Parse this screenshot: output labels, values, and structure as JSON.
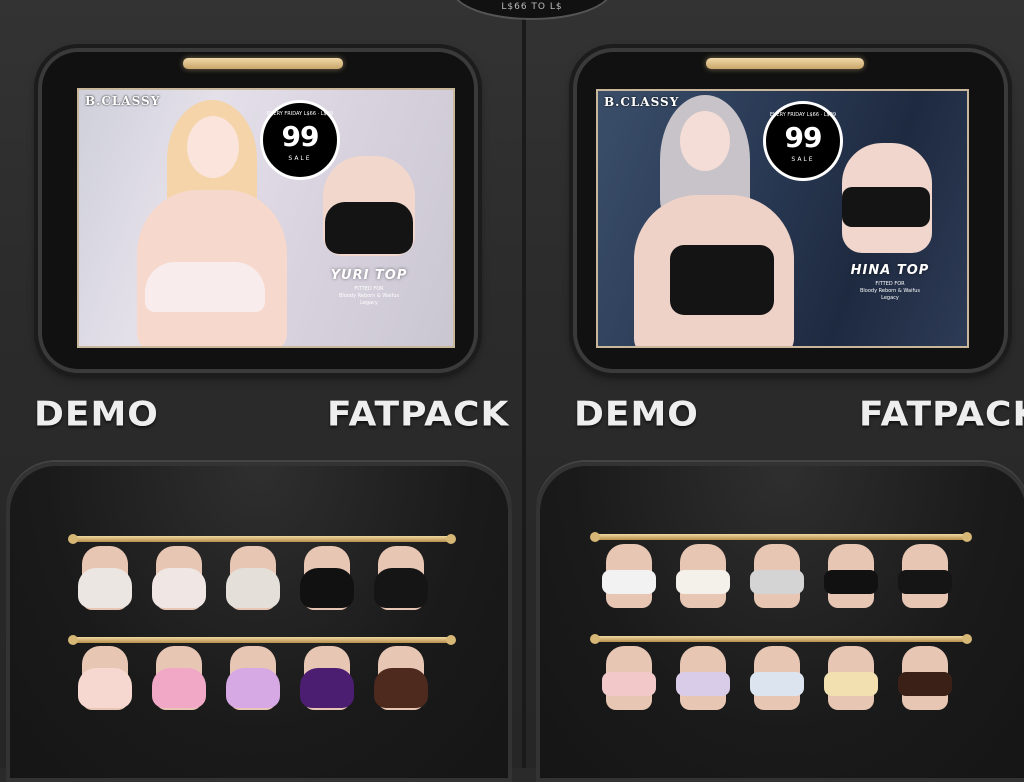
{
  "top_badge": {
    "text": "L$66 TO L$"
  },
  "left_panel": {
    "poster": {
      "brand": "B.CLASSY",
      "sale_top_text": "EVERY FRIDAY\nL$66 · L$99",
      "sale_number": "99",
      "sale_label": "SALE",
      "product_name": "YURI TOP",
      "product_sub": "FITTED FOR\nBloody Reborn & Waifus\nLegacy"
    },
    "demo_label": "DEMO",
    "fatpack_label": "FATPACK",
    "rows": [
      {
        "colors": [
          "#ece6e2",
          "#f0e6e4",
          "#e4dfd9",
          "#111111",
          "#151515"
        ]
      },
      {
        "colors": [
          "#f6d8d0",
          "#f0a8c6",
          "#d6a8e4",
          "#4c1e72",
          "#4e2a1e"
        ]
      }
    ]
  },
  "right_panel": {
    "poster": {
      "brand": "B.CLASSY",
      "sale_top_text": "EVERY FRIDAY\nL$66 · L$99",
      "sale_number": "99",
      "sale_label": "SALE",
      "product_name": "HINA TOP",
      "product_sub": "FITTED FOR\nBloody Reborn & Waifus\nLegacy"
    },
    "demo_label": "DEMO",
    "fatpack_label": "FATPACK",
    "rows": [
      {
        "colors": [
          "#f2f2f2",
          "#f4f0ea",
          "#d4d4d4",
          "#111111",
          "#151515"
        ]
      },
      {
        "colors": [
          "#f2c8c8",
          "#d8cce8",
          "#dce4f0",
          "#f2e0b0",
          "#3a2016"
        ]
      }
    ]
  }
}
